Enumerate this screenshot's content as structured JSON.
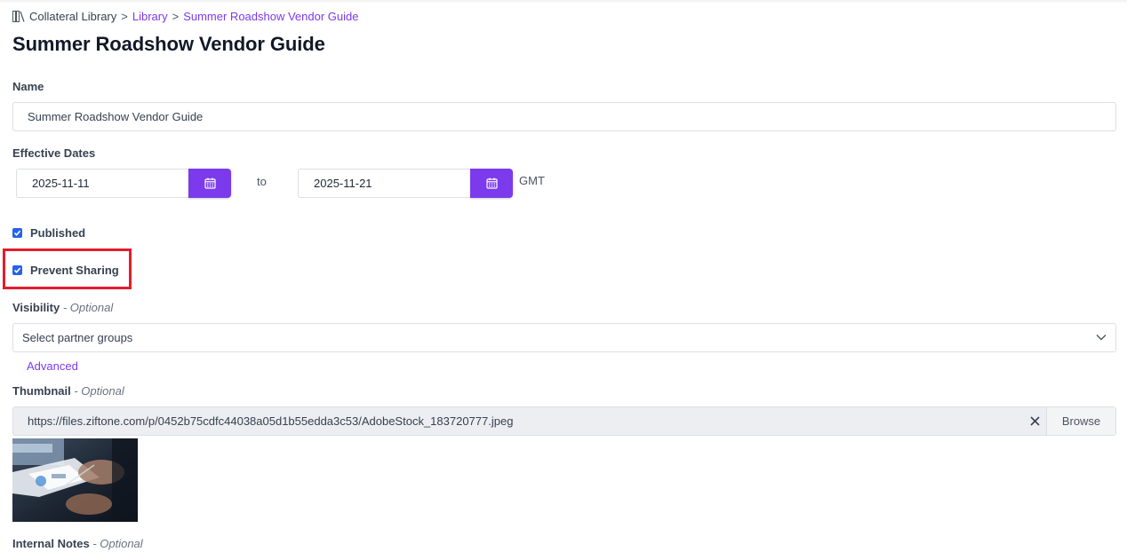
{
  "breadcrumb": {
    "root": "Collateral Library",
    "separator": ">",
    "library": "Library",
    "current": "Summer Roadshow Vendor Guide"
  },
  "page_title": "Summer Roadshow Vendor Guide",
  "name_field": {
    "label": "Name",
    "value": "Summer Roadshow Vendor Guide"
  },
  "effective_dates": {
    "label": "Effective Dates",
    "start": "2025-11-11",
    "to_text": "to",
    "end": "2025-11-21",
    "timezone": "GMT",
    "button_icon": "calendar-icon"
  },
  "published": {
    "label": "Published",
    "checked": true
  },
  "prevent_sharing": {
    "label": "Prevent Sharing",
    "checked": true,
    "highlight_color": "#e11d2e"
  },
  "visibility": {
    "label": "Visibility",
    "optional": "- Optional",
    "placeholder": "Select partner groups",
    "advanced_link": "Advanced"
  },
  "thumbnail": {
    "label": "Thumbnail",
    "optional": "- Optional",
    "url": "https://files.ziftone.com/p/0452b75cdfc44038a05d1b55edda3c53/AdobeStock_183720777.jpeg",
    "browse_label": "Browse"
  },
  "internal_notes": {
    "label": "Internal Notes",
    "optional": "- Optional"
  },
  "colors": {
    "accent": "#7c3aed",
    "checkbox": "#2563eb",
    "highlight": "#e11d2e"
  }
}
